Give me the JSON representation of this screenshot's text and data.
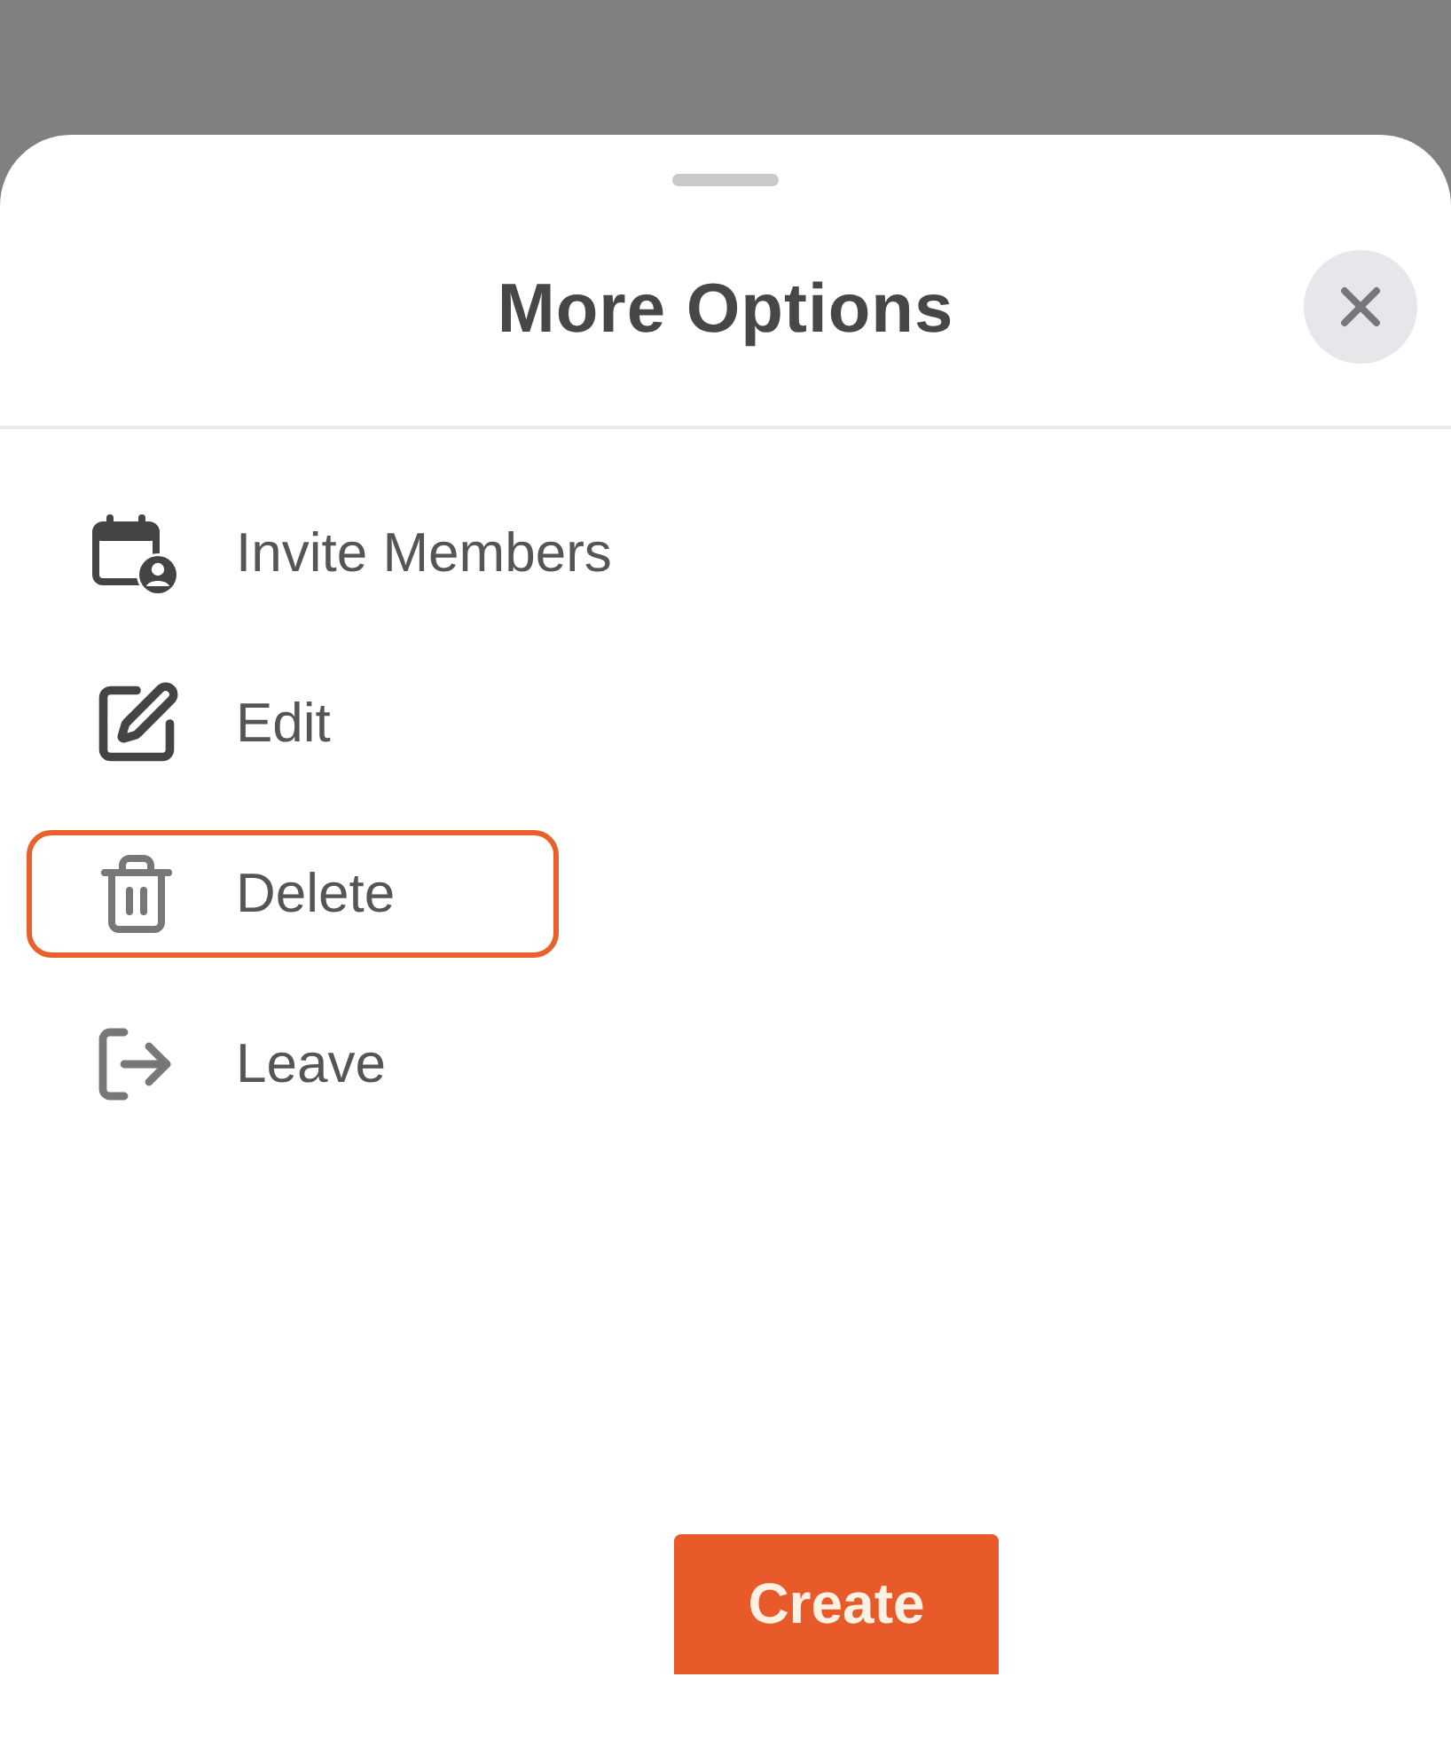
{
  "sheet": {
    "title": "More Options"
  },
  "menu_items": [
    {
      "kind": "invite",
      "label": "Invite Members",
      "selected": false
    },
    {
      "kind": "edit",
      "label": "Edit",
      "selected": false
    },
    {
      "kind": "delete",
      "label": "Delete",
      "selected": true
    },
    {
      "kind": "leave",
      "label": "Leave",
      "selected": false
    }
  ],
  "primary_button": {
    "label": "Create"
  }
}
